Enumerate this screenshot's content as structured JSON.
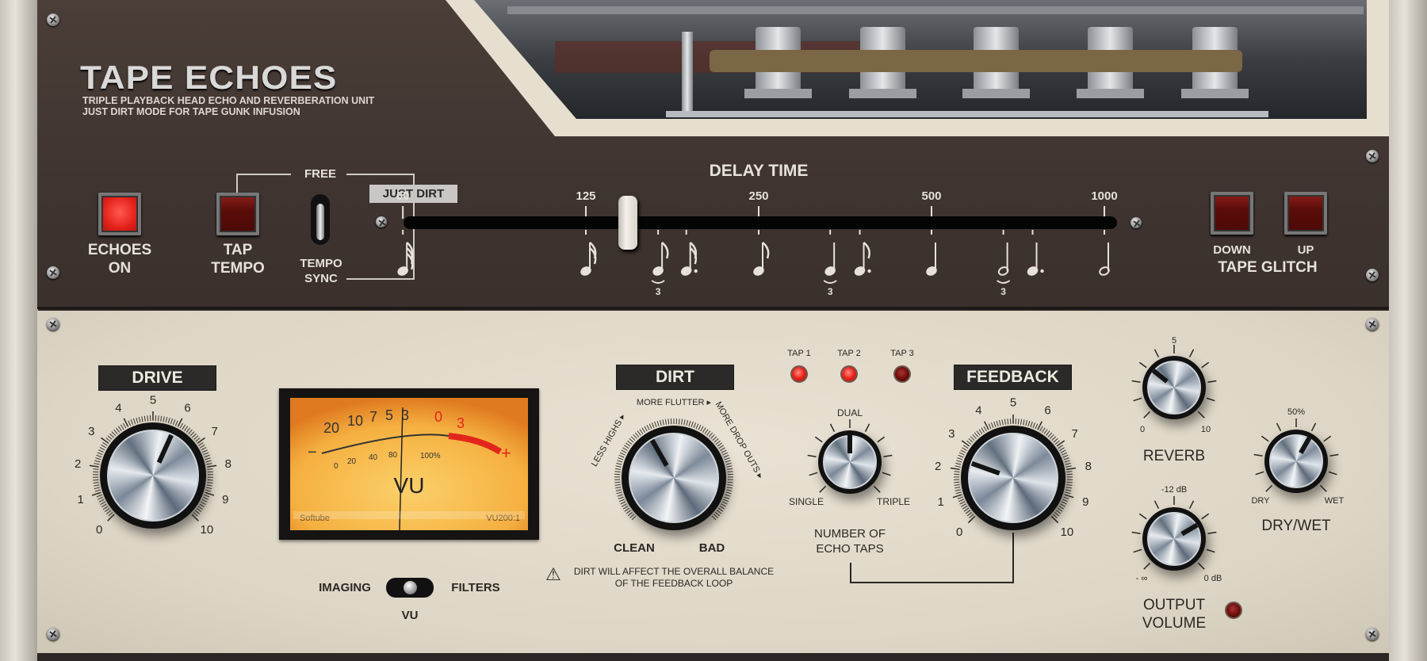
{
  "header": {
    "title": "TAPE ECHOES",
    "subtitle_1": "TRIPLE PLAYBACK HEAD ECHO AND REVERBERATION UNIT",
    "subtitle_2": "JUST DIRT MODE FOR TAPE GUNK INFUSION"
  },
  "echoes_on": {
    "label_1": "ECHOES",
    "label_2": "ON",
    "state": "on"
  },
  "tap_tempo": {
    "label_1": "TAP",
    "label_2": "TEMPO",
    "state": "off"
  },
  "sync_switch": {
    "top_label": "FREE",
    "bottom_label_1": "TEMPO",
    "bottom_label_2": "SYNC",
    "position": "tempo-sync"
  },
  "delay": {
    "title": "DELAY TIME",
    "just_dirt": "JUST DIRT",
    "value_ms": 148,
    "ticks": [
      "60",
      "125",
      "250",
      "500",
      "1000"
    ],
    "notes": [
      {
        "ms": 60,
        "type": "thirty-second-note"
      },
      {
        "ms": 125,
        "type": "sixteenth-note"
      },
      {
        "ms": 167,
        "type": "eighth-note-triplet",
        "tuplet": "3"
      },
      {
        "ms": 187,
        "type": "dotted-sixteenth-note"
      },
      {
        "ms": 250,
        "type": "eighth-note"
      },
      {
        "ms": 333,
        "type": "quarter-note-triplet",
        "tuplet": "3"
      },
      {
        "ms": 375,
        "type": "dotted-eighth-note"
      },
      {
        "ms": 500,
        "type": "quarter-note"
      },
      {
        "ms": 667,
        "type": "half-note-triplet",
        "tuplet": "3"
      },
      {
        "ms": 750,
        "type": "dotted-quarter-note"
      },
      {
        "ms": 1000,
        "type": "half-note"
      }
    ]
  },
  "tape_glitch": {
    "title": "TAPE GLITCH",
    "down": "DOWN",
    "up": "UP"
  },
  "drive": {
    "label": "DRIVE",
    "value": 5.9,
    "scale": [
      "0",
      "1",
      "2",
      "3",
      "4",
      "5",
      "6",
      "7",
      "8",
      "9",
      "10"
    ]
  },
  "vu": {
    "scale_db": [
      "20",
      "10",
      "7",
      "5",
      "3",
      "0",
      "3"
    ],
    "scale_pct": [
      "0",
      "20",
      "40",
      "80",
      "100%"
    ],
    "minus": "−",
    "plus": "+",
    "label": "VU",
    "brand": "Softube",
    "model": "VU200:1",
    "colors": {
      "face": "#f5b040",
      "red": "#e3261b"
    }
  },
  "meter_switch": {
    "left": "IMAGING",
    "right": "FILTERS",
    "bottom": "VU",
    "position": "vu"
  },
  "dirt": {
    "label": "DIRT",
    "value": 0.39,
    "clean": "CLEAN",
    "bad": "BAD",
    "less_highs": "LESS HIGHS ▸",
    "more_flutter": "MORE FLUTTER ▸",
    "more_drop_outs": "MORE DROP OUTS ▸",
    "warning_1": "DIRT WILL AFFECT THE OVERALL BALANCE",
    "warning_2": "OF THE FEEDBACK LOOP"
  },
  "taps": {
    "leds": [
      {
        "label": "TAP 1",
        "state": "on"
      },
      {
        "label": "TAP 2",
        "state": "on"
      },
      {
        "label": "TAP 3",
        "state": "off"
      }
    ],
    "dual": "DUAL",
    "single": "SINGLE",
    "triple": "TRIPLE",
    "title_1": "NUMBER OF",
    "title_2": "ECHO TAPS",
    "value": "DUAL"
  },
  "feedback": {
    "label": "FEEDBACK",
    "value": 2.4,
    "scale": [
      "0",
      "1",
      "2",
      "3",
      "4",
      "5",
      "6",
      "7",
      "8",
      "9",
      "10"
    ]
  },
  "reverb": {
    "label": "REVERB",
    "value": 3.1,
    "min": "0",
    "mid": "5",
    "max": "10"
  },
  "output": {
    "label_1": "OUTPUT",
    "label_2": "VOLUME",
    "min": "- ∞",
    "mid": "-12 dB",
    "max": "0 dB",
    "angle_fraction": 0.72,
    "led_state": "off"
  },
  "drywet": {
    "label": "DRY/WET",
    "min": "DRY",
    "mid": "50%",
    "max": "WET",
    "value_percent": 61
  }
}
